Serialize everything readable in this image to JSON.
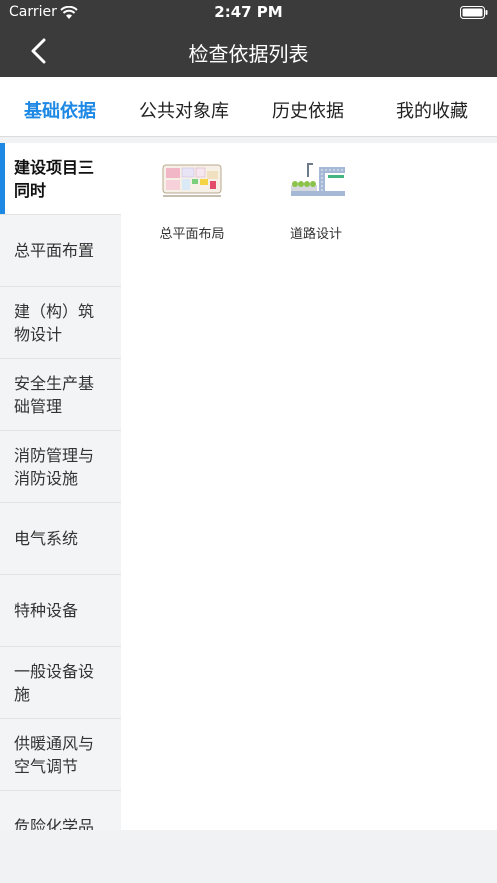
{
  "status_bar": {
    "carrier": "Carrier",
    "time": "2:47 PM"
  },
  "nav": {
    "title": "检查依据列表",
    "back_icon": "chevron-left-icon"
  },
  "tabs": [
    {
      "label": "基础依据",
      "active": true
    },
    {
      "label": "公共对象库",
      "active": false
    },
    {
      "label": "历史依据",
      "active": false
    },
    {
      "label": "我的收藏",
      "active": false
    }
  ],
  "sidebar": {
    "items": [
      {
        "label": "建设项目三同时",
        "active": true
      },
      {
        "label": "总平面布置"
      },
      {
        "label": "建（构）筑物设计"
      },
      {
        "label": "安全生产基础管理"
      },
      {
        "label": "消防管理与消防设施"
      },
      {
        "label": "电气系统"
      },
      {
        "label": "特种设备"
      },
      {
        "label": "一般设备设施"
      },
      {
        "label": "供暖通风与空气调节"
      },
      {
        "label": "危险化学品"
      }
    ]
  },
  "content": {
    "items": [
      {
        "label": "总平面布局",
        "icon": "floor-plan-icon"
      },
      {
        "label": "道路设计",
        "icon": "road-design-icon"
      }
    ]
  },
  "colors": {
    "accent": "#1e88e5",
    "bar": "#3b3b3b"
  }
}
